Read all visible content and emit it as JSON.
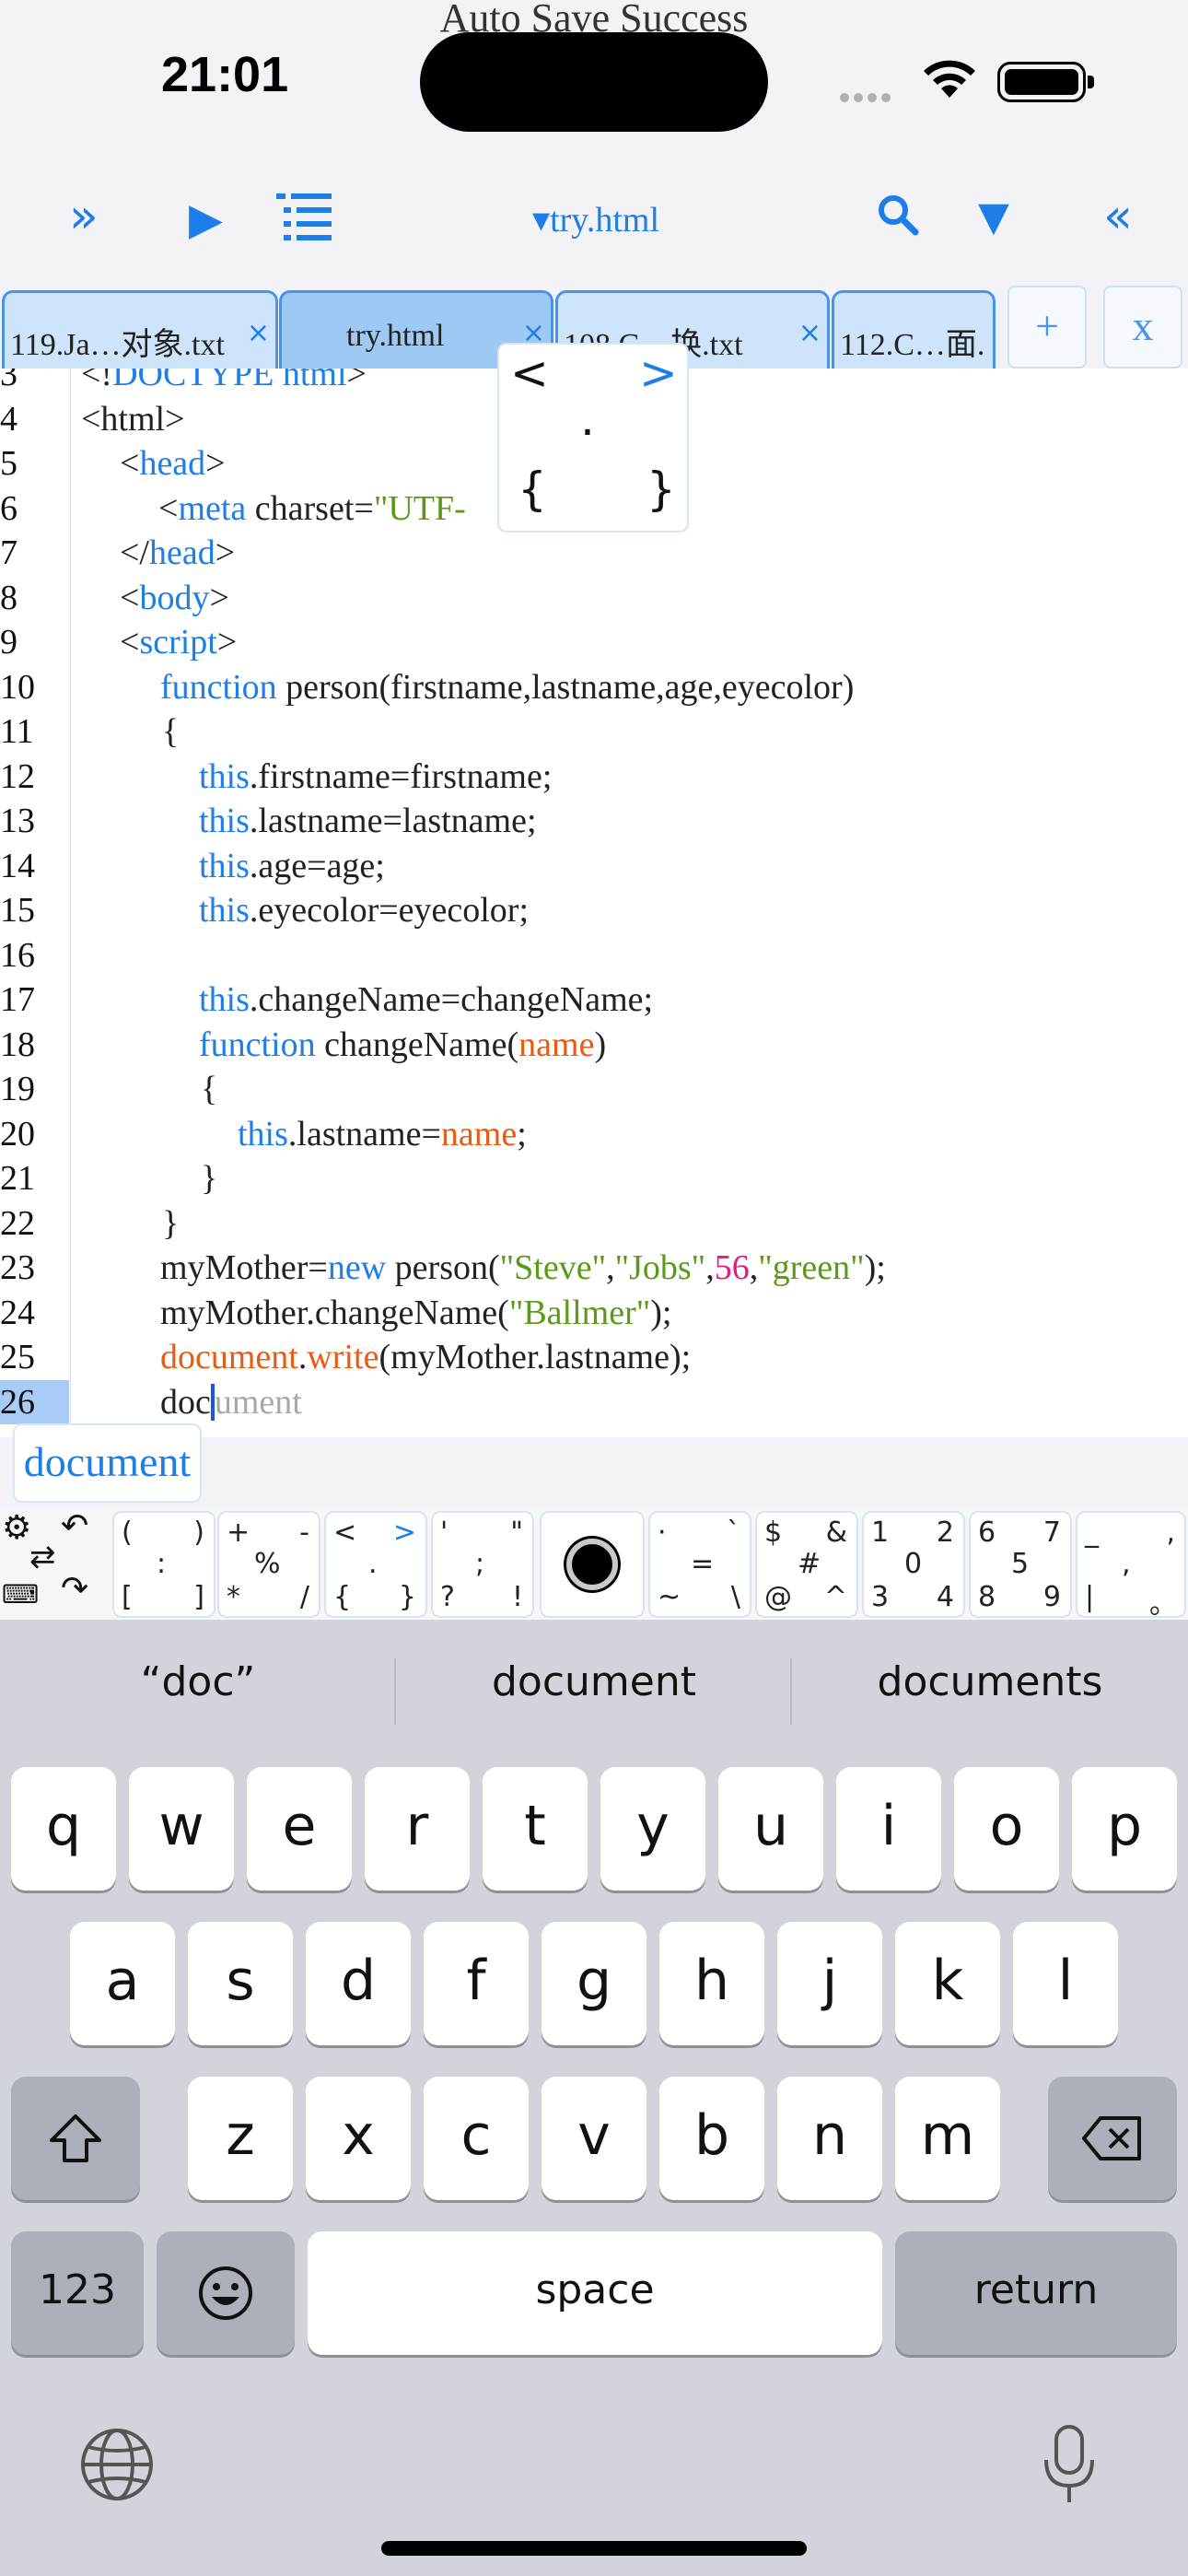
{
  "status_bar": {
    "toast": "Auto Save Success",
    "time": "21:01"
  },
  "toolbar": {
    "expand_icon": "»",
    "run_icon": "▶",
    "filename": "try.html",
    "filename_prefix": "▾",
    "filter_icon": "▼",
    "collapse_icon": "«",
    "accent": "#1e7ee8"
  },
  "tabs": [
    {
      "label": "119.Ja…对象.txt",
      "close": "×"
    },
    {
      "label": "try.html",
      "close": "×"
    },
    {
      "label": "108.C…换.txt",
      "close": "×"
    },
    {
      "label": "112.C…面.",
      "close": ""
    }
  ],
  "tab_actions": {
    "add": "+",
    "close_all": "x"
  },
  "editor": {
    "current_line": "26",
    "lines": [
      {
        "n": "3",
        "text": "<!DOCTYPE html>"
      },
      {
        "n": "4",
        "text": "<html>"
      },
      {
        "n": "5",
        "text": "<head>"
      },
      {
        "n": "6",
        "text": "<meta charset=\"UTF-"
      },
      {
        "n": "7",
        "text": "</head>"
      },
      {
        "n": "8",
        "text": "<body>"
      },
      {
        "n": "9",
        "text": "<script>"
      },
      {
        "n": "10",
        "text": "function person(firstname,lastname,age,eyecolor)"
      },
      {
        "n": "11",
        "text": "{"
      },
      {
        "n": "12",
        "text": "this.firstname=firstname;"
      },
      {
        "n": "13",
        "text": "this.lastname=lastname;"
      },
      {
        "n": "14",
        "text": "this.age=age;"
      },
      {
        "n": "15",
        "text": "this.eyecolor=eyecolor;"
      },
      {
        "n": "16",
        "text": ""
      },
      {
        "n": "17",
        "text": "this.changeName=changeName;"
      },
      {
        "n": "18",
        "text": "function changeName(name)"
      },
      {
        "n": "19",
        "text": "{"
      },
      {
        "n": "20",
        "text": "this.lastname=name;"
      },
      {
        "n": "21",
        "text": "}"
      },
      {
        "n": "22",
        "text": "}"
      },
      {
        "n": "23",
        "text": "myMother=new person(\"Steve\",\"Jobs\",56,\"green\");"
      },
      {
        "n": "24",
        "text": "myMother.changeName(\"Ballmer\");"
      },
      {
        "n": "25",
        "text": "document.write(myMother.lastname);"
      },
      {
        "n": "26",
        "text": "document"
      }
    ],
    "typed": "doc",
    "ghost_completion": "ument"
  },
  "symbol_popup": {
    "lt": "<",
    "gt": ">",
    "dot": ".",
    "lbrace": "{",
    "rbrace": "}"
  },
  "autocomplete": {
    "suggestion": "document"
  },
  "symbol_bar": {
    "keys": [
      {
        "tl": "(",
        "tr": ")",
        "c": ":",
        "bl": "[",
        "br": "]"
      },
      {
        "tl": "+",
        "tr": "-",
        "c": "%",
        "bl": "*",
        "br": "/"
      },
      {
        "tl": "<",
        "tr": ">",
        "c": ".",
        "bl": "{",
        "br": "}"
      },
      {
        "tl": "'",
        "tr": "\"",
        "c": ";",
        "bl": "?",
        "br": "!"
      },
      {
        "tl": "·",
        "tr": "`",
        "c": "=",
        "bl": "~",
        "br": "\\"
      },
      {
        "tl": "$",
        "tr": "&",
        "c": "#",
        "bl": "@",
        "br": "^"
      },
      {
        "tl": "1",
        "tr": "2",
        "c": "0",
        "bl": "3",
        "br": "4"
      },
      {
        "tl": "6",
        "tr": "7",
        "c": "5",
        "bl": "8",
        "br": "9"
      },
      {
        "tl": "_",
        "tr": ",",
        "c": ",",
        "bl": "|",
        "br": "。"
      }
    ],
    "tool_icons": [
      "gear-icon",
      "undo-icon",
      "swap-icon",
      "keyboard-icon",
      "redo-icon"
    ]
  },
  "keyboard": {
    "suggestions": [
      "“doc”",
      "document",
      "documents"
    ],
    "row1": [
      "q",
      "w",
      "e",
      "r",
      "t",
      "y",
      "u",
      "i",
      "o",
      "p"
    ],
    "row2": [
      "a",
      "s",
      "d",
      "f",
      "g",
      "h",
      "j",
      "k",
      "l"
    ],
    "row3": [
      "z",
      "x",
      "c",
      "v",
      "b",
      "n",
      "m"
    ],
    "numbers_key": "123",
    "space_key": "space",
    "return_key": "return"
  }
}
